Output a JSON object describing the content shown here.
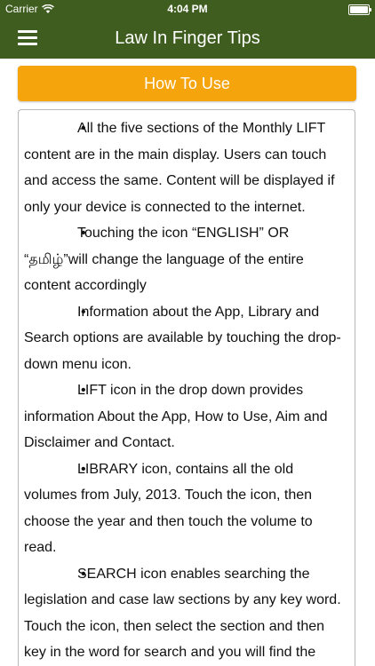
{
  "status_bar": {
    "carrier": "Carrier",
    "time": "4:04 PM",
    "wifi_icon": "wifi-icon",
    "battery_icon": "battery-icon"
  },
  "nav": {
    "title": "Law In Finger Tips",
    "menu_icon": "hamburger-menu-icon"
  },
  "how_to_use_button": "How To Use",
  "tips": [
    "All the five sections of the Monthly LIFT content are in the main display. Users can touch and access the same. Content will be displayed if only your device is connected to the internet.",
    "Touching the icon “ENGLISH” OR “தமிழ்”will change the language of the entire content accordingly",
    "Information about the App, Library and Search options are available by touching the drop-down menu icon.",
    "LIFT icon in the drop down provides information About the App, How to Use, Aim and Disclaimer and Contact.",
    "LIBRARY icon, contains all the old volumes from July, 2013. Touch the icon, then choose the year and then touch the volume to read.",
    "SEARCH icon enables searching the legislation and case law sections by any key word. Touch the icon, then select the section and then key in the word for search and you will find the relevant case or legislation."
  ],
  "colors": {
    "nav_background": "#3f5d1f",
    "button_background": "#f5a40c",
    "button_text": "#ffffff"
  }
}
